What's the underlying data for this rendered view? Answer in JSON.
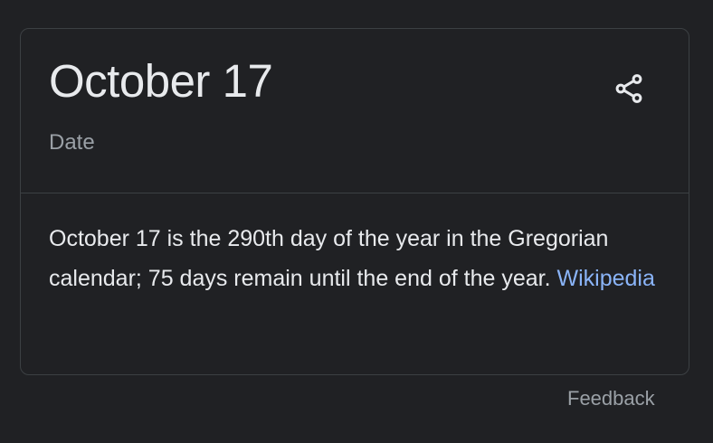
{
  "card": {
    "title": "October 17",
    "subtitle": "Date",
    "share_icon": "share-icon",
    "description": "October 17 is the 290th day of the year in the Gregorian calendar; 75 days remain until the end of the year.",
    "source_link": "Wikipedia"
  },
  "footer": {
    "feedback_label": "Feedback"
  },
  "colors": {
    "background": "#202124",
    "border": "#3c4043",
    "title_text": "#e8eaed",
    "secondary_text": "#9aa0a6",
    "link": "#8ab4f8"
  }
}
